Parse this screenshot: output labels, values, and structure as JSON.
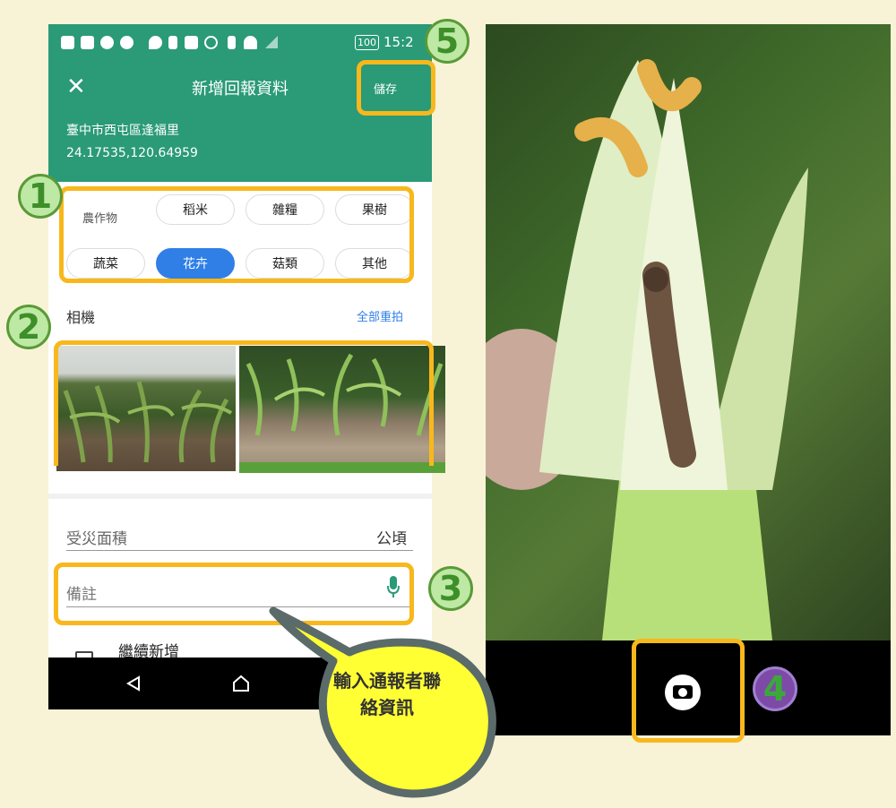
{
  "statusbar": {
    "battery": "100",
    "time": "15:2"
  },
  "appbar": {
    "title": "新增回報資料",
    "save_label": "儲存",
    "close_label": "✕"
  },
  "location": {
    "name": "臺中市西屯區逢福里",
    "coords": "24.17535,120.64959"
  },
  "crop": {
    "label": "農作物",
    "options": [
      "稻米",
      "雜糧",
      "果樹",
      "蔬菜",
      "花卉",
      "菇類",
      "其他"
    ],
    "selected": "花卉"
  },
  "camera": {
    "label": "相機",
    "retake_all": "全部重拍"
  },
  "area": {
    "label": "受災面積",
    "unit": "公頃"
  },
  "note": {
    "placeholder": "備註"
  },
  "continue_add": {
    "label": "繼續新增"
  },
  "badges": {
    "b1": "1",
    "b2": "2",
    "b3": "3",
    "b4": "4",
    "b5": "5"
  },
  "callout": {
    "text": "輸入通報者聯絡資訊"
  },
  "colors": {
    "header_green": "#2a9a77",
    "selected_chip": "#2f7fe6",
    "highlight": "#f8b81c",
    "badge_green": "#bde9a4",
    "background": "#f8f3d6"
  },
  "icons": {
    "close": "close-icon",
    "mic": "mic-icon",
    "back": "back-triangle-icon",
    "home": "home-icon",
    "shutter": "camera-shutter-icon"
  }
}
